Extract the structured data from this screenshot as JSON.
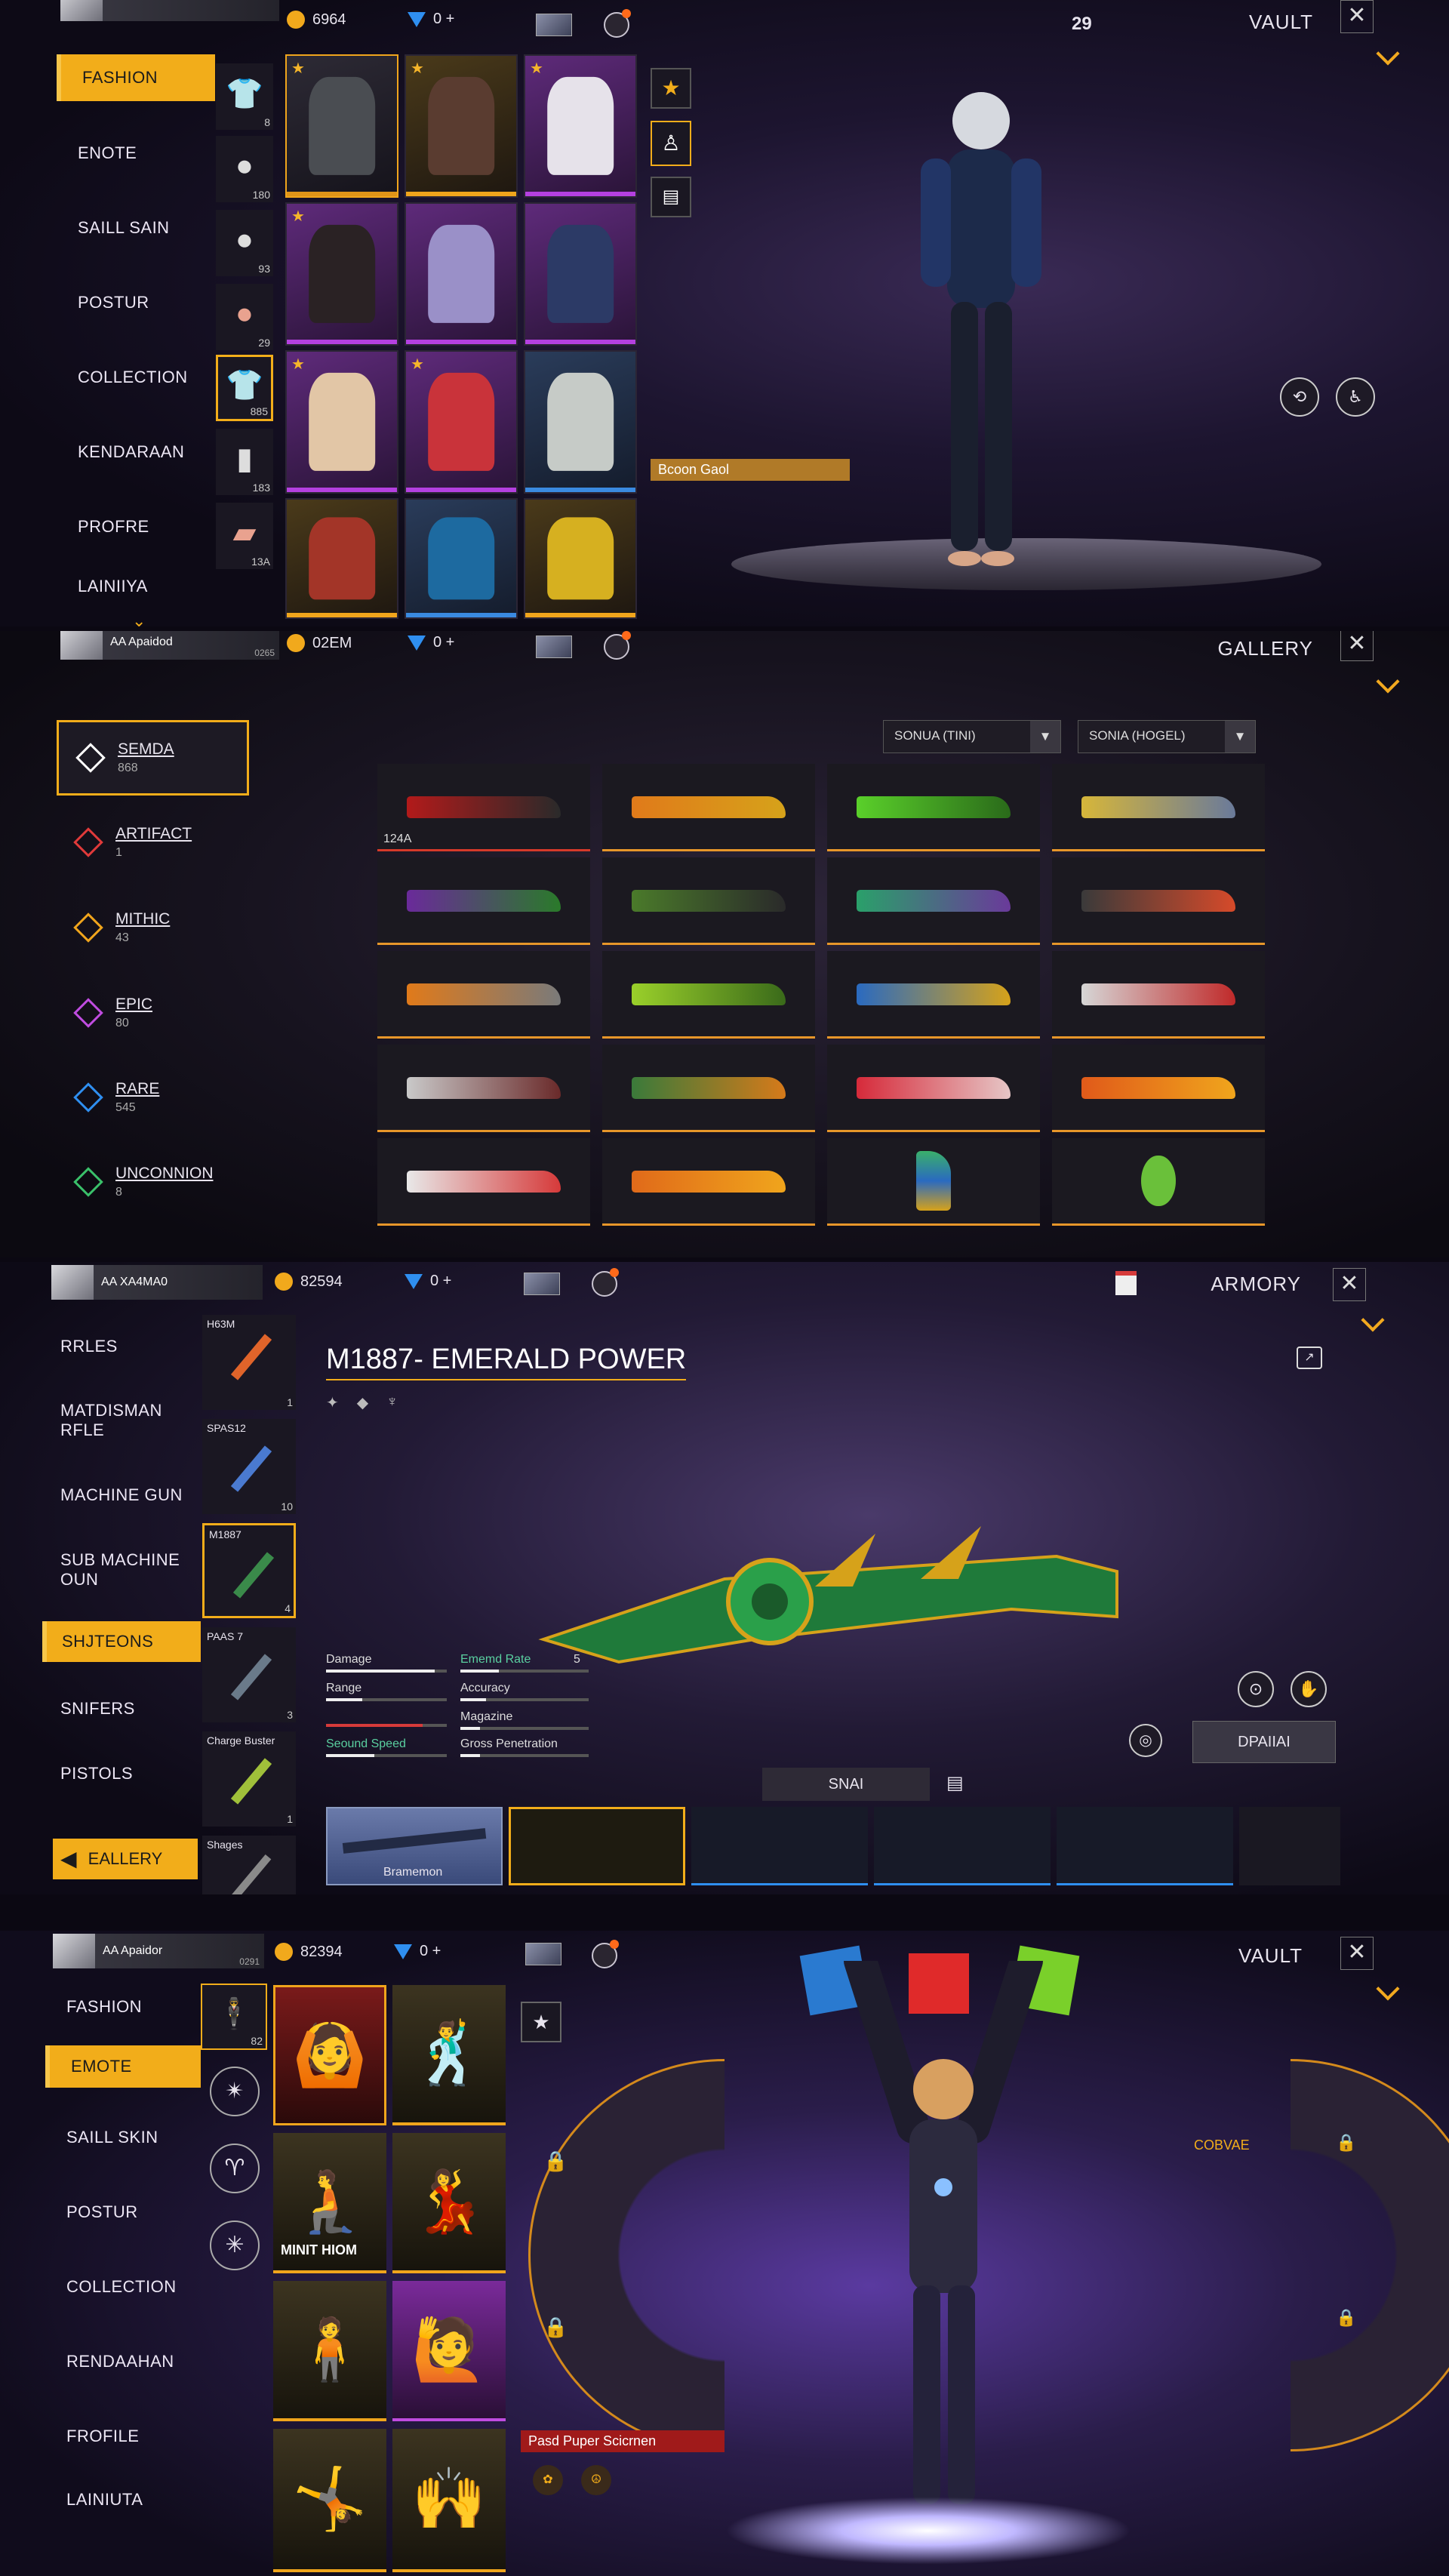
{
  "panel1": {
    "topbar": {
      "coins": "6964",
      "diamonds": "0 +",
      "badge": "29",
      "title": "VAULT"
    },
    "menu": [
      "FASHION",
      "ENOTE",
      "SAILL SAIN",
      "POSTUR",
      "COLLECTION",
      "KENDARAAN",
      "PROFRE",
      "LAINIIYA"
    ],
    "active_menu": "FASHION",
    "column_counts": [
      "8",
      "180",
      "93",
      "29",
      "885",
      "183",
      "13A"
    ],
    "tag_label": "Bcoon Gaol"
  },
  "panel2": {
    "topbar": {
      "player": "AA  Apaidod",
      "level": "0265",
      "coins": "02EM",
      "diamonds": "0 +",
      "title": "GALLERY"
    },
    "rarities": [
      {
        "name": "SEMDA",
        "count": "868"
      },
      {
        "name": "ARTIFACT",
        "count": "1"
      },
      {
        "name": "MITHIC",
        "count": "43"
      },
      {
        "name": "EPIC",
        "count": "80"
      },
      {
        "name": "RARE",
        "count": "545"
      },
      {
        "name": "UNCONNION",
        "count": "8"
      }
    ],
    "dropdowns": [
      "SONUA (TINI)",
      "SONIA (HOGEL)"
    ],
    "first_tile_label": "124A"
  },
  "panel3": {
    "topbar": {
      "player": "AA  XA4MA0",
      "coins": "82594",
      "diamonds": "0 +",
      "title": "ARMORY"
    },
    "menu": [
      "RRLES",
      "MATDISMAN RFLE",
      "MACHINE GUN",
      "SUB MACHINE OUN",
      "SHJTEONS",
      "SNIFERS",
      "PISTOLS"
    ],
    "active_menu": "SHJTEONS",
    "gallery_button": "EALLERY",
    "weapon_title": "M1887- EMERALD POWER",
    "column_items": [
      {
        "name": "H63M",
        "count": "1"
      },
      {
        "name": "SPAS12",
        "count": "10"
      },
      {
        "name": "M1887",
        "count": "4"
      },
      {
        "name": "PAAS 7",
        "count": "3"
      },
      {
        "name": "Charge Buster",
        "count": "1"
      },
      {
        "name": "Shages",
        "count": ""
      }
    ],
    "stats_left": [
      "Damage",
      "Range",
      "",
      "Seound Speed"
    ],
    "stats_right": [
      "Ememd Rate",
      "Accuracy",
      "Magazine",
      "Gross Penetration"
    ],
    "stat_value": "5",
    "equip_label": "DPAIIAI",
    "skin_tab": "SNAI",
    "first_skin_label": "Bramemon"
  },
  "panel4": {
    "topbar": {
      "player": "AA  Apaidor",
      "level": "0291",
      "coins": "82394",
      "diamonds": "0 +",
      "title": "VAULT"
    },
    "menu": [
      "FASHION",
      "EMOTE",
      "SAILL SKIN",
      "POSTUR",
      "COLLECTION",
      "RENDAAHAN",
      "FROFILE",
      "LAINIUTA"
    ],
    "active_menu": "EMOTE",
    "column_count": "82",
    "emote_tile_label": "MINIT HIOM",
    "wheel_label": "COBVAE",
    "bottom_tag": "Pasd Puper Scicrnen"
  }
}
